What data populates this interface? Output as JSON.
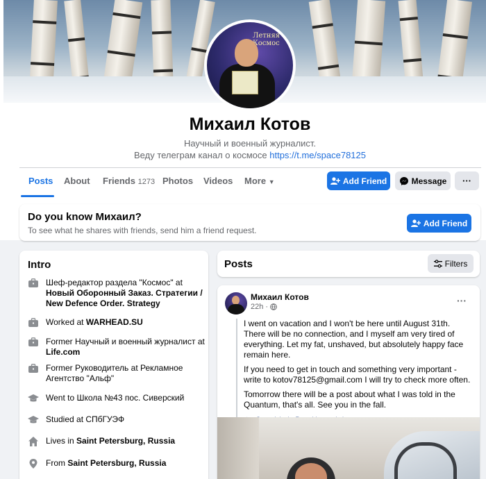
{
  "profile": {
    "name": "Михаил Котов",
    "bio_line1": "Научный и военный журналист.",
    "bio_line2": "Веду телеграм канал о космосе",
    "bio_link": "https://t.me/space78125",
    "avatar_text": "Летняя Космос"
  },
  "tabs": [
    {
      "label": "Posts"
    },
    {
      "label": "About"
    },
    {
      "label": "Friends",
      "count": "1273"
    },
    {
      "label": "Photos"
    },
    {
      "label": "Videos"
    },
    {
      "label": "More"
    }
  ],
  "actions": {
    "add_friend": "Add Friend",
    "message": "Message",
    "more": "···"
  },
  "suggest": {
    "title": "Do you know Михаил?",
    "subtitle": "To see what he shares with friends, send him a friend request.",
    "button": "Add Friend"
  },
  "intro": {
    "title": "Intro",
    "items": [
      {
        "icon": "briefcase-icon",
        "line1": "Шеф-редактор раздела \"Космос\" at",
        "bold": "Новый Оборонный Заказ. Стратегии / New Defence Order. Strategy"
      },
      {
        "icon": "briefcase-icon",
        "line1": "Worked at",
        "bold": "WARHEAD.SU"
      },
      {
        "icon": "briefcase-icon",
        "line1": "Former Научный и военный журналист at",
        "bold": "Life.com"
      },
      {
        "icon": "briefcase-icon",
        "line1": "Former Руководитель at Рекламное Агентство \"Альф\"",
        "bold": ""
      },
      {
        "icon": "graduation-cap-icon",
        "line1": "Went to Школа №43 пос. Сиверский",
        "bold": ""
      },
      {
        "icon": "graduation-cap-icon",
        "line1": "Studied at СПбГУЭФ",
        "bold": ""
      },
      {
        "icon": "home-icon",
        "line1": "Lives in",
        "bold": "Saint Petersburg, Russia"
      },
      {
        "icon": "location-pin-icon",
        "line1": "From",
        "bold": "Saint Petersburg, Russia"
      }
    ]
  },
  "posts": {
    "title": "Posts",
    "filters": "Filters",
    "post": {
      "author": "Михаил Котов",
      "time": "22h",
      "p1": "I went on vacation and I won't be here until August 31th. There will be no connection, and I myself am very tired of everything. Let my fat, unshaved, but absolutely happy face remain here.",
      "p2": "If you need to get in touch and something very important - write to kotov78125@gmail.com I will try to check more often.",
      "p3": "Tomorrow there will be a post about what I was told in the Quantum, that's all. See you in the fall.",
      "see_original": "See original",
      "rate": "Rate this translation",
      "dot": "·",
      "menu": "···"
    }
  },
  "colors": {
    "accent": "#1b74e4",
    "secondary_text": "#65676b",
    "page_bg": "#f0f2f5"
  }
}
